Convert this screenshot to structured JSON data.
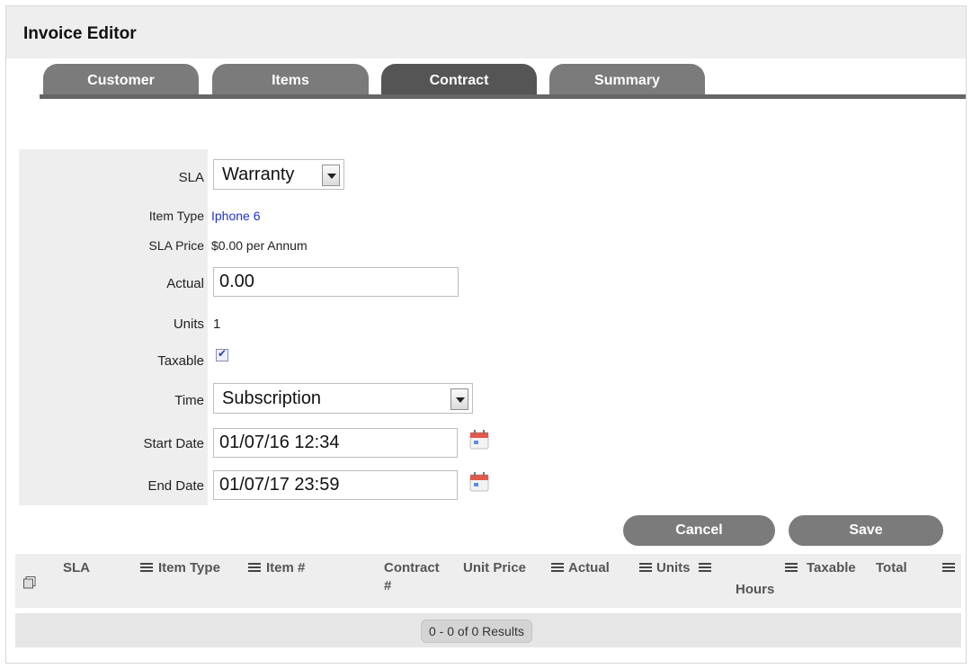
{
  "window": {
    "title": "Invoice Editor"
  },
  "tabs": [
    {
      "label": "Customer",
      "active": false
    },
    {
      "label": "Items",
      "active": false
    },
    {
      "label": "Contract",
      "active": true
    },
    {
      "label": "Summary",
      "active": false
    }
  ],
  "form": {
    "sla": {
      "label": "SLA",
      "value": "Warranty"
    },
    "item_type": {
      "label": "Item Type",
      "value": "Iphone 6"
    },
    "sla_price": {
      "label": "SLA Price",
      "value": "$0.00 per Annum"
    },
    "actual": {
      "label": "Actual",
      "value": "0.00"
    },
    "units": {
      "label": "Units",
      "value": "1"
    },
    "taxable": {
      "label": "Taxable",
      "checked": true
    },
    "time": {
      "label": "Time",
      "value": "Subscription"
    },
    "start_date": {
      "label": "Start Date",
      "value": "01/07/16 12:34"
    },
    "end_date": {
      "label": "End Date",
      "value": "01/07/17 23:59"
    }
  },
  "buttons": {
    "cancel": "Cancel",
    "save": "Save"
  },
  "grid": {
    "columns": [
      "SLA",
      "Item Type",
      "Item #",
      "Contract",
      "#",
      "Unit Price",
      "Actual",
      "Units",
      "Hours",
      "Taxable",
      "Total"
    ],
    "results": "0 - 0 of 0 Results"
  },
  "colors": {
    "tab": "#7b7b7b",
    "tab_active": "#555555",
    "link": "#1e32c8"
  },
  "icons": [
    "select-all-icon",
    "column-menu-icon",
    "calendar-icon",
    "dropdown-arrow-icon",
    "checkbox-checked-icon"
  ]
}
